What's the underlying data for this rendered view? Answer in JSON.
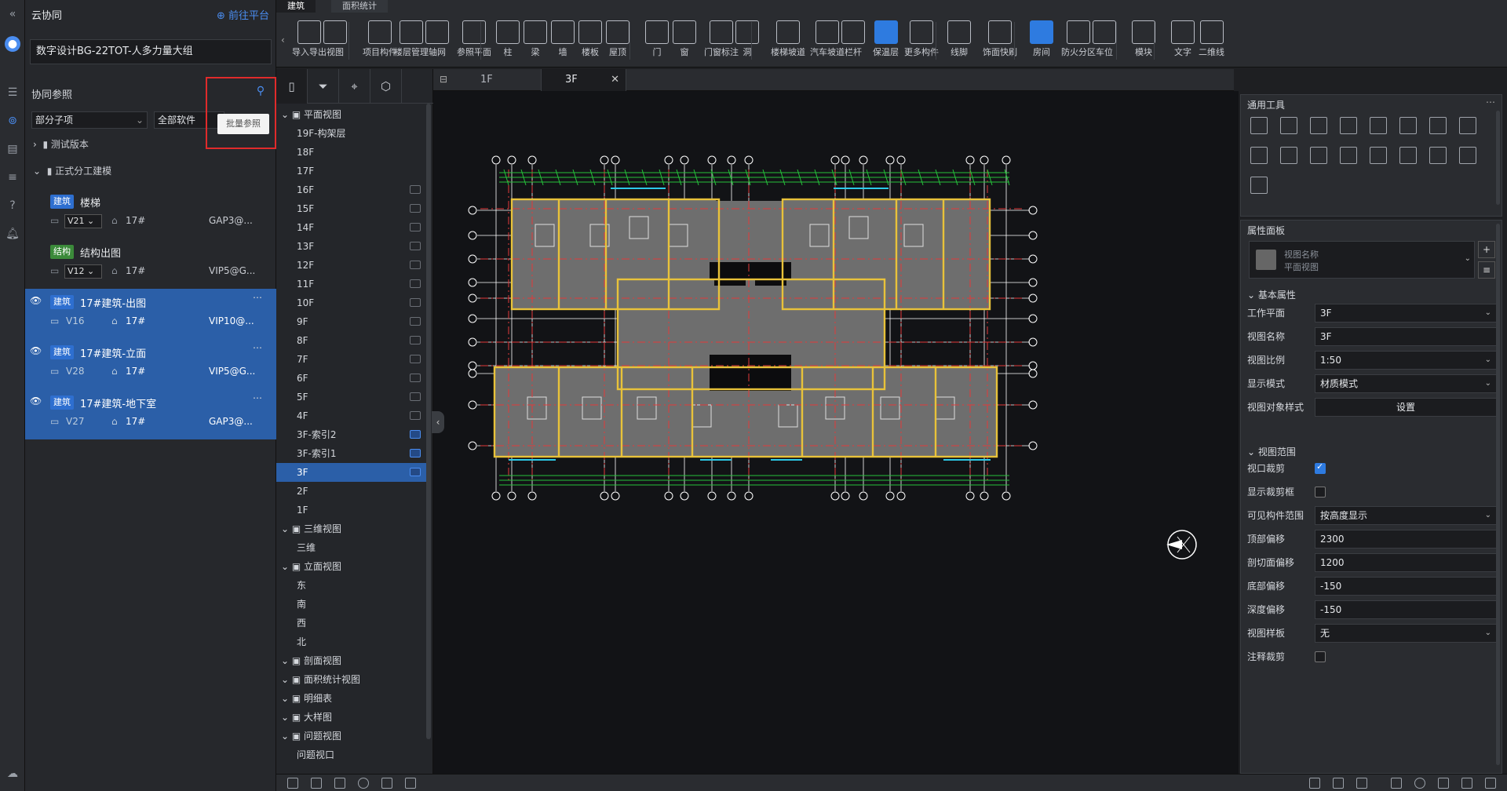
{
  "collab": {
    "title": "云协同",
    "goto_platform": "前往平台",
    "project_name": "数字设计BG-22TOT-人多力量大组",
    "section_title": "协同参照",
    "filter_scope": "部分子项",
    "filter_software": "全部软件",
    "batch_tooltip": "批量参照",
    "groups": [
      {
        "label": "测试版本"
      },
      {
        "label": "正式分工建模"
      }
    ],
    "items": [
      {
        "tag": "建筑",
        "name": "楼梯",
        "version": "V21",
        "building": "17#",
        "owner": "GAP3@..."
      },
      {
        "tag": "结构",
        "name": "结构出图",
        "version": "V12",
        "building": "17#",
        "owner": "VIP5@G..."
      },
      {
        "tag": "建筑",
        "name": "17#建筑-出图",
        "version": "V16",
        "building": "17#",
        "owner": "VIP10@..."
      },
      {
        "tag": "建筑",
        "name": "17#建筑-立面",
        "version": "V28",
        "building": "17#",
        "owner": "VIP5@G..."
      },
      {
        "tag": "建筑",
        "name": "17#建筑-地下室",
        "version": "V27",
        "building": "17#",
        "owner": "GAP3@..."
      }
    ]
  },
  "toolbar": {
    "tabs": [
      "建筑",
      "面积统计"
    ],
    "tools": [
      "导入导出",
      "视图",
      "项目构件",
      "楼层管理",
      "轴网",
      "参照平面",
      "柱",
      "梁",
      "墙",
      "楼板",
      "屋顶",
      "门",
      "窗",
      "门窗标注",
      "洞",
      "楼梯坡道",
      "汽车坡道",
      "栏杆",
      "保温层",
      "更多构件",
      "线脚",
      "饰面快刷",
      "房间",
      "防火分区",
      "车位",
      "模块",
      "文字",
      "二维线"
    ]
  },
  "viewtree": {
    "rows": [
      {
        "label": "平面视图",
        "kind": "group"
      },
      {
        "label": "19F-构架层"
      },
      {
        "label": "18F"
      },
      {
        "label": "17F"
      },
      {
        "label": "16F",
        "badge": "g"
      },
      {
        "label": "15F",
        "badge": "g"
      },
      {
        "label": "14F",
        "badge": "g"
      },
      {
        "label": "13F",
        "badge": "g"
      },
      {
        "label": "12F",
        "badge": "g"
      },
      {
        "label": "11F",
        "badge": "g"
      },
      {
        "label": "10F",
        "badge": "g"
      },
      {
        "label": "9F",
        "badge": "g"
      },
      {
        "label": "8F",
        "badge": "g"
      },
      {
        "label": "7F",
        "badge": "g"
      },
      {
        "label": "6F",
        "badge": "g"
      },
      {
        "label": "5F",
        "badge": "g"
      },
      {
        "label": "4F",
        "badge": "g"
      },
      {
        "label": "3F-索引2",
        "badge": "b"
      },
      {
        "label": "3F-索引1",
        "badge": "b"
      },
      {
        "label": "3F",
        "badge": "b",
        "current": true
      },
      {
        "label": "2F"
      },
      {
        "label": "1F"
      },
      {
        "label": "三维视图",
        "kind": "group"
      },
      {
        "label": "三维"
      },
      {
        "label": "立面视图",
        "kind": "group"
      },
      {
        "label": "东"
      },
      {
        "label": "南"
      },
      {
        "label": "西"
      },
      {
        "label": "北"
      },
      {
        "label": "剖面视图",
        "kind": "group"
      },
      {
        "label": "面积统计视图",
        "kind": "group"
      },
      {
        "label": "明细表",
        "kind": "group"
      },
      {
        "label": "大样图",
        "kind": "group"
      },
      {
        "label": "问题视图",
        "kind": "group"
      },
      {
        "label": "问题视口"
      }
    ]
  },
  "canvas_tabs": [
    "1F",
    "3F"
  ],
  "tools_panel": {
    "title": "通用工具"
  },
  "props": {
    "title": "属性面板",
    "selector_line1": "视图名称",
    "selector_line2": "平面视图",
    "basic_section": "基本属性",
    "range_section": "视图范围",
    "rows": [
      {
        "key": "工作平面",
        "value": "3F",
        "type": "select"
      },
      {
        "key": "视图名称",
        "value": "3F",
        "type": "text"
      },
      {
        "key": "视图比例",
        "value": "1:50",
        "type": "select"
      },
      {
        "key": "显示模式",
        "value": "材质模式",
        "type": "select"
      },
      {
        "key": "视图对象样式",
        "value": "设置",
        "type": "button"
      }
    ],
    "range_rows": [
      {
        "key": "视口裁剪",
        "type": "check",
        "checked": true
      },
      {
        "key": "显示裁剪框",
        "type": "check",
        "checked": false
      },
      {
        "key": "可见构件范围",
        "value": "按高度显示",
        "type": "select"
      },
      {
        "key": "顶部偏移",
        "value": "2300",
        "type": "text"
      },
      {
        "key": "剖切面偏移",
        "value": "1200",
        "type": "text"
      },
      {
        "key": "底部偏移",
        "value": "-150",
        "type": "text"
      },
      {
        "key": "深度偏移",
        "value": "-150",
        "type": "text"
      },
      {
        "key": "视图样板",
        "value": "无",
        "type": "select"
      },
      {
        "key": "注释裁剪",
        "type": "check",
        "checked": false
      }
    ]
  },
  "colors": {
    "accent": "#2e7be0",
    "selected_row": "#2b5fa8",
    "highlight_box": "#e02b2b"
  }
}
